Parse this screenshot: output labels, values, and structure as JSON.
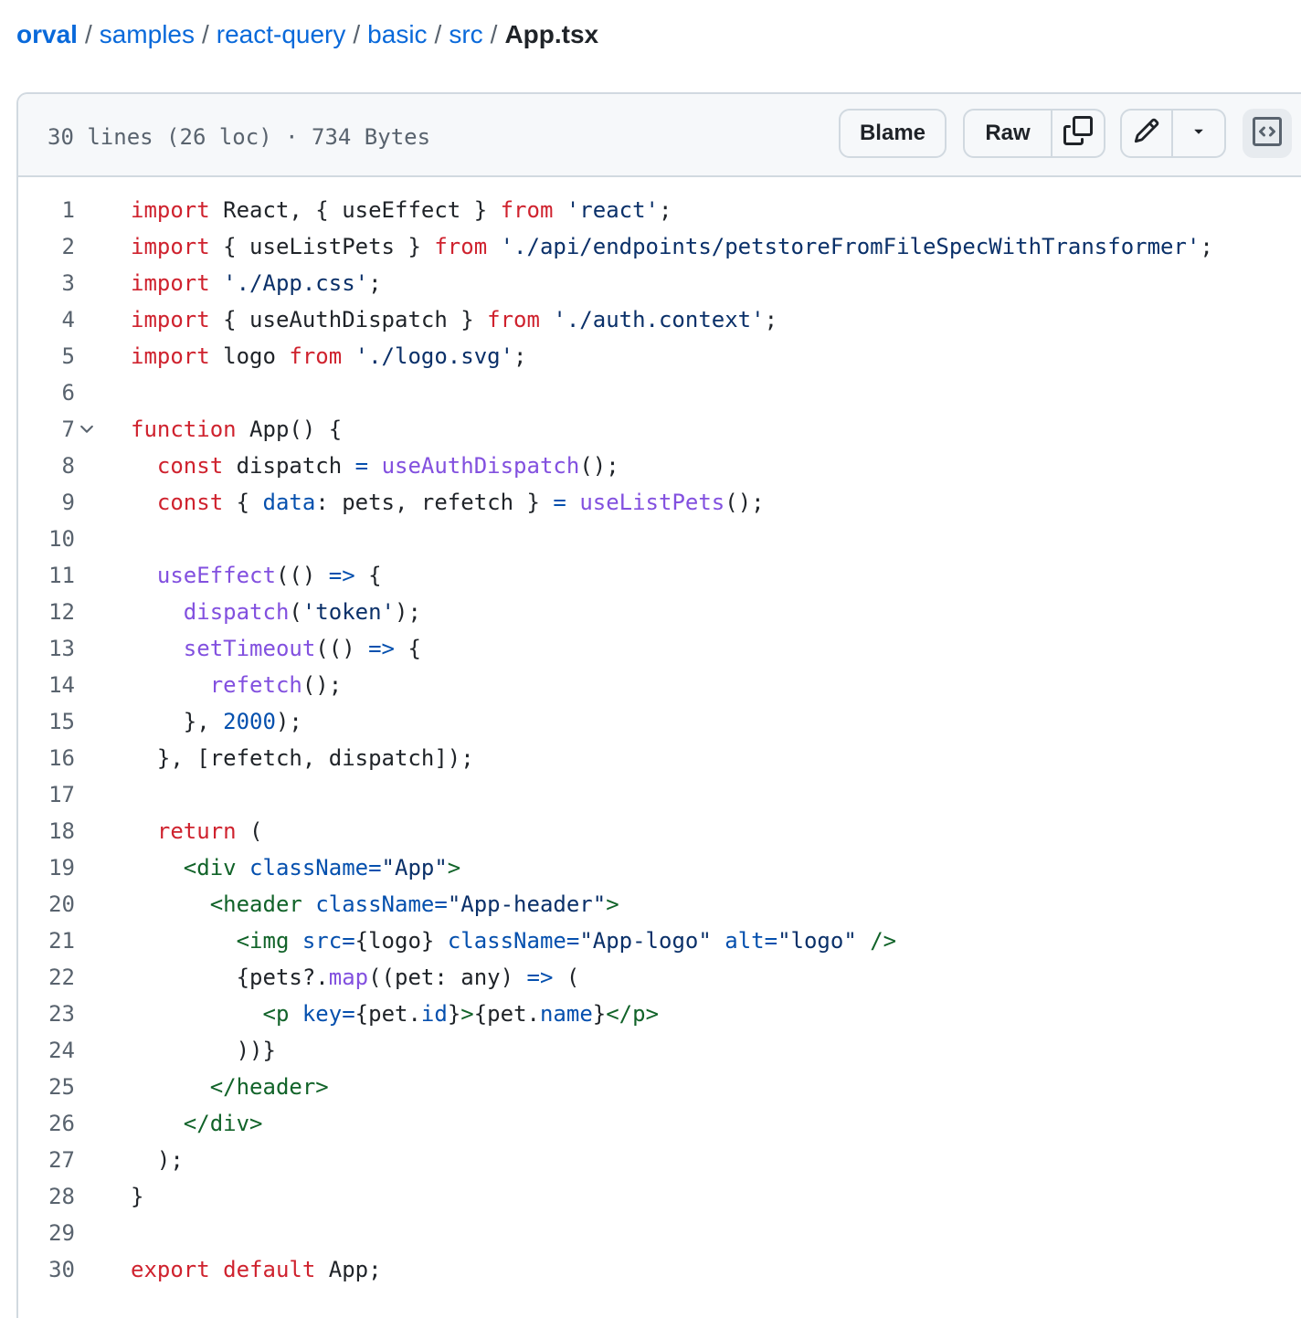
{
  "breadcrumb": {
    "repo": "orval",
    "path": [
      "samples",
      "react-query",
      "basic",
      "src"
    ],
    "separator": "/",
    "file": "App.tsx"
  },
  "file_info": {
    "lines": "30 lines (26 loc)",
    "dot": "·",
    "size": "734 Bytes"
  },
  "toolbar": {
    "blame_label": "Blame",
    "raw_label": "Raw",
    "copy_icon": "copy-icon",
    "edit_icon": "pencil-icon",
    "more_icon": "triangle-down-icon",
    "symbols_icon": "code-square-icon"
  },
  "colors": {
    "keyword": "#cf222e",
    "string": "#0a3069",
    "function": "#8250df",
    "constant": "#0550ae",
    "tag": "#116329",
    "link": "#0969da"
  },
  "code": [
    {
      "n": "1",
      "tokens": [
        [
          "k",
          "import"
        ],
        [
          "p",
          " React, { useEffect } "
        ],
        [
          "k",
          "from"
        ],
        [
          "p",
          " "
        ],
        [
          "s",
          "'react'"
        ],
        [
          "p",
          ";"
        ]
      ]
    },
    {
      "n": "2",
      "tokens": [
        [
          "k",
          "import"
        ],
        [
          "p",
          " { useListPets } "
        ],
        [
          "k",
          "from"
        ],
        [
          "p",
          " "
        ],
        [
          "s",
          "'./api/endpoints/petstoreFromFileSpecWithTransformer'"
        ],
        [
          "p",
          ";"
        ]
      ]
    },
    {
      "n": "3",
      "tokens": [
        [
          "k",
          "import"
        ],
        [
          "p",
          " "
        ],
        [
          "s",
          "'./App.css'"
        ],
        [
          "p",
          ";"
        ]
      ]
    },
    {
      "n": "4",
      "tokens": [
        [
          "k",
          "import"
        ],
        [
          "p",
          " { useAuthDispatch } "
        ],
        [
          "k",
          "from"
        ],
        [
          "p",
          " "
        ],
        [
          "s",
          "'./auth.context'"
        ],
        [
          "p",
          ";"
        ]
      ]
    },
    {
      "n": "5",
      "tokens": [
        [
          "k",
          "import"
        ],
        [
          "p",
          " logo "
        ],
        [
          "k",
          "from"
        ],
        [
          "p",
          " "
        ],
        [
          "s",
          "'./logo.svg'"
        ],
        [
          "p",
          ";"
        ]
      ]
    },
    {
      "n": "6",
      "tokens": []
    },
    {
      "n": "7",
      "fold": true,
      "tokens": [
        [
          "k",
          "function"
        ],
        [
          "p",
          " App() {"
        ]
      ]
    },
    {
      "n": "8",
      "tokens": [
        [
          "p",
          "  "
        ],
        [
          "k",
          "const"
        ],
        [
          "p",
          " dispatch "
        ],
        [
          "c",
          "="
        ],
        [
          "p",
          " "
        ],
        [
          "f",
          "useAuthDispatch"
        ],
        [
          "p",
          "();"
        ]
      ]
    },
    {
      "n": "9",
      "tokens": [
        [
          "p",
          "  "
        ],
        [
          "k",
          "const"
        ],
        [
          "p",
          " { "
        ],
        [
          "c",
          "data"
        ],
        [
          "p",
          ": pets, refetch } "
        ],
        [
          "c",
          "="
        ],
        [
          "p",
          " "
        ],
        [
          "f",
          "useListPets"
        ],
        [
          "p",
          "();"
        ]
      ]
    },
    {
      "n": "10",
      "tokens": []
    },
    {
      "n": "11",
      "tokens": [
        [
          "p",
          "  "
        ],
        [
          "f",
          "useEffect"
        ],
        [
          "p",
          "(() "
        ],
        [
          "c",
          "=>"
        ],
        [
          "p",
          " {"
        ]
      ]
    },
    {
      "n": "12",
      "tokens": [
        [
          "p",
          "    "
        ],
        [
          "f",
          "dispatch"
        ],
        [
          "p",
          "("
        ],
        [
          "s",
          "'token'"
        ],
        [
          "p",
          ");"
        ]
      ]
    },
    {
      "n": "13",
      "tokens": [
        [
          "p",
          "    "
        ],
        [
          "f",
          "setTimeout"
        ],
        [
          "p",
          "(() "
        ],
        [
          "c",
          "=>"
        ],
        [
          "p",
          " {"
        ]
      ]
    },
    {
      "n": "14",
      "tokens": [
        [
          "p",
          "      "
        ],
        [
          "f",
          "refetch"
        ],
        [
          "p",
          "();"
        ]
      ]
    },
    {
      "n": "15",
      "tokens": [
        [
          "p",
          "    }, "
        ],
        [
          "c",
          "2000"
        ],
        [
          "p",
          ");"
        ]
      ]
    },
    {
      "n": "16",
      "tokens": [
        [
          "p",
          "  }, [refetch, dispatch]);"
        ]
      ]
    },
    {
      "n": "17",
      "tokens": []
    },
    {
      "n": "18",
      "tokens": [
        [
          "p",
          "  "
        ],
        [
          "k",
          "return"
        ],
        [
          "p",
          " ("
        ]
      ]
    },
    {
      "n": "19",
      "tokens": [
        [
          "p",
          "    "
        ],
        [
          "t",
          "<div"
        ],
        [
          "p",
          " "
        ],
        [
          "c",
          "className"
        ],
        [
          "c",
          "="
        ],
        [
          "s",
          "\"App\""
        ],
        [
          "t",
          ">"
        ]
      ]
    },
    {
      "n": "20",
      "tokens": [
        [
          "p",
          "      "
        ],
        [
          "t",
          "<header"
        ],
        [
          "p",
          " "
        ],
        [
          "c",
          "className"
        ],
        [
          "c",
          "="
        ],
        [
          "s",
          "\"App-header\""
        ],
        [
          "t",
          ">"
        ]
      ]
    },
    {
      "n": "21",
      "tokens": [
        [
          "p",
          "        "
        ],
        [
          "t",
          "<img"
        ],
        [
          "p",
          " "
        ],
        [
          "c",
          "src"
        ],
        [
          "c",
          "="
        ],
        [
          "p",
          "{logo} "
        ],
        [
          "c",
          "className"
        ],
        [
          "c",
          "="
        ],
        [
          "s",
          "\"App-logo\""
        ],
        [
          "p",
          " "
        ],
        [
          "c",
          "alt"
        ],
        [
          "c",
          "="
        ],
        [
          "s",
          "\"logo\""
        ],
        [
          "p",
          " "
        ],
        [
          "t",
          "/>"
        ]
      ]
    },
    {
      "n": "22",
      "tokens": [
        [
          "p",
          "        {pets?."
        ],
        [
          "f",
          "map"
        ],
        [
          "p",
          "((pet: any) "
        ],
        [
          "c",
          "=>"
        ],
        [
          "p",
          " ("
        ]
      ]
    },
    {
      "n": "23",
      "tokens": [
        [
          "p",
          "          "
        ],
        [
          "t",
          "<p"
        ],
        [
          "p",
          " "
        ],
        [
          "c",
          "key"
        ],
        [
          "c",
          "="
        ],
        [
          "p",
          "{pet."
        ],
        [
          "c",
          "id"
        ],
        [
          "p",
          "}"
        ],
        [
          "t",
          ">"
        ],
        [
          "p",
          "{pet."
        ],
        [
          "c",
          "name"
        ],
        [
          "p",
          "}"
        ],
        [
          "t",
          "</p>"
        ]
      ]
    },
    {
      "n": "24",
      "tokens": [
        [
          "p",
          "        ))}"
        ]
      ]
    },
    {
      "n": "25",
      "tokens": [
        [
          "p",
          "      "
        ],
        [
          "t",
          "</header>"
        ]
      ]
    },
    {
      "n": "26",
      "tokens": [
        [
          "p",
          "    "
        ],
        [
          "t",
          "</div>"
        ]
      ]
    },
    {
      "n": "27",
      "tokens": [
        [
          "p",
          "  );"
        ]
      ]
    },
    {
      "n": "28",
      "tokens": [
        [
          "p",
          "}"
        ]
      ]
    },
    {
      "n": "29",
      "tokens": []
    },
    {
      "n": "30",
      "tokens": [
        [
          "k",
          "export"
        ],
        [
          "p",
          " "
        ],
        [
          "k",
          "default"
        ],
        [
          "p",
          " App;"
        ]
      ]
    }
  ]
}
